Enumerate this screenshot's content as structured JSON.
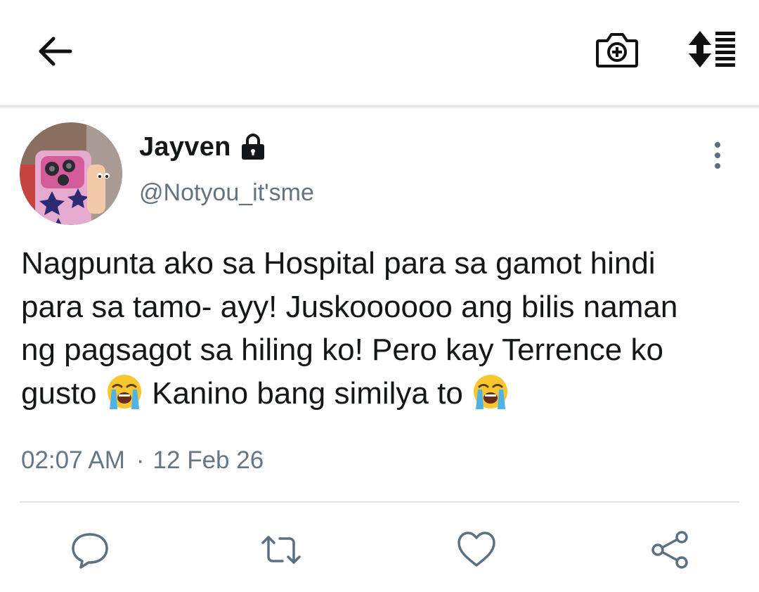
{
  "header": {
    "icons": {
      "back": "arrow-left-icon",
      "camera": "camera-plus-icon",
      "sort": "sort-list-icon"
    }
  },
  "tweet": {
    "author": {
      "name": "Jayven",
      "handle": "@Notyou_it'sme",
      "protected_icon": "lock-icon",
      "avatar_icon": "avatar-photo"
    },
    "text_lines": [
      "Nagpunta ako sa Hospital para sa gamot hindi",
      "para sa tamo- ayy! Juskoooooo ang bilis naman",
      "ng pagsagot sa hiling ko! Pero kay Terrence ko",
      "gusto",
      "Kanino bang similya to"
    ],
    "emoji": "loudly-crying-face",
    "time": "02:07 AM",
    "separator": "·",
    "date": "12 Feb 26"
  },
  "actions": {
    "icons": [
      "reply-icon",
      "retweet-icon",
      "like-icon",
      "share-icon"
    ]
  },
  "colors": {
    "text": "#14171a",
    "secondary": "#657786",
    "divider": "#e3e6e9",
    "action_icon": "#5b7083"
  }
}
